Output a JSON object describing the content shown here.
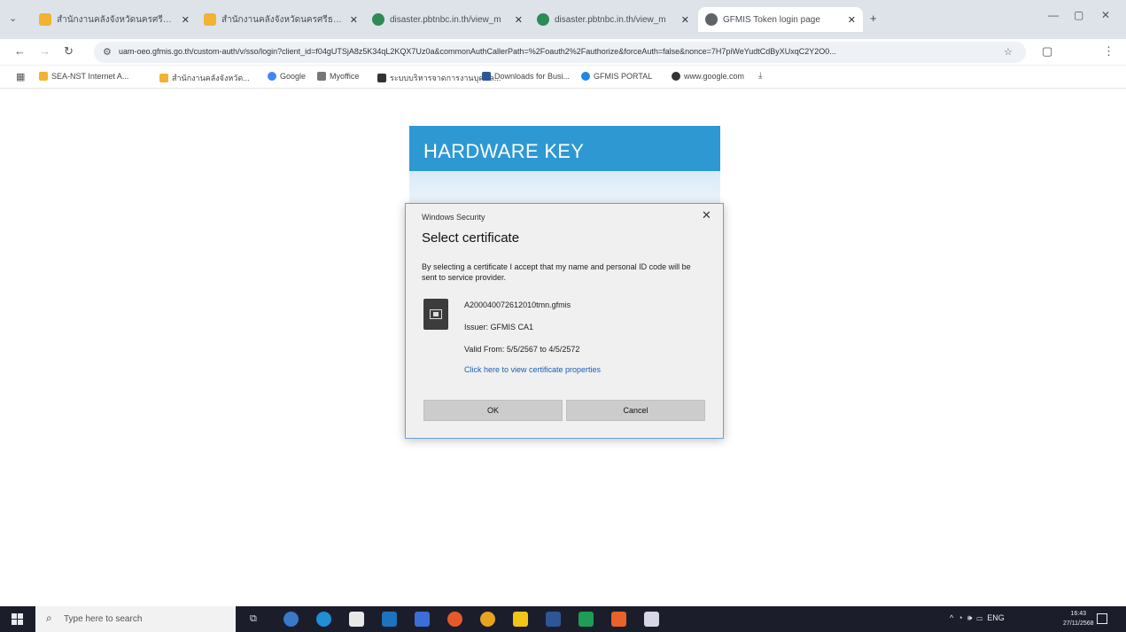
{
  "browser": {
    "tabs": [
      {
        "title": "สำนักงานคลังจังหวัดนครศรีธรรมราช",
        "favicon_color": "#f2b233"
      },
      {
        "title": "สำนักงานคลังจังหวัดนครศรีธรรมราช",
        "favicon_color": "#f2b233"
      },
      {
        "title": "disaster.pbtnbc.in.th/view_m",
        "favicon_color": "#2e8b57"
      },
      {
        "title": "disaster.pbtnbc.in.th/view_m",
        "favicon_color": "#2e8b57"
      },
      {
        "title": "GFMIS Token login page",
        "favicon_color": "#5f6368"
      }
    ],
    "new_tab_label": "+",
    "url": "uam-oeo.gfmis.go.th/custom-auth/v/sso/login?client_id=f04gUTSjA8z5K34qL2KQX7Uz0a&commonAuthCallerPath=%2Foauth2%2Fauthorize&forceAuth=false&nonce=7H7piWeYudtCdByXUxqC2Y2O0...",
    "bookmarks": [
      {
        "label": "SEA-NST Internet A...",
        "color": "#f2b233"
      },
      {
        "label": "สำนักงานคลังจังหวัด...",
        "color": "#f2b233"
      },
      {
        "label": "Google",
        "color": "#4285f4"
      },
      {
        "label": "Myoffice",
        "color": "#777777"
      },
      {
        "label": "ระบบบริหารจาดการงานบุคคล...",
        "color": "#333333"
      },
      {
        "label": "Downloads for Busi...",
        "color": "#2b5797"
      },
      {
        "label": "GFMIS PORTAL",
        "color": "#1e88e5"
      },
      {
        "label": "www.google.com",
        "color": "#333333"
      }
    ]
  },
  "page": {
    "header": "HARDWARE KEY"
  },
  "dialog": {
    "caption": "Windows Security",
    "title": "Select certificate",
    "description": "By selecting a certificate I accept that my name and personal ID code will be sent to service provider.",
    "cert_name": "A200040072612010tmn.gfmis",
    "issuer": "Issuer: GFMIS CA1",
    "validity": "Valid From: 5/5/2567 to 4/5/2572",
    "link": "Click here to view certificate properties",
    "ok_label": "OK",
    "cancel_label": "Cancel"
  },
  "taskbar": {
    "search_placeholder": "Type here to search",
    "tray_lang": "ENG",
    "time": "16:43",
    "date": "27/11/2568"
  }
}
